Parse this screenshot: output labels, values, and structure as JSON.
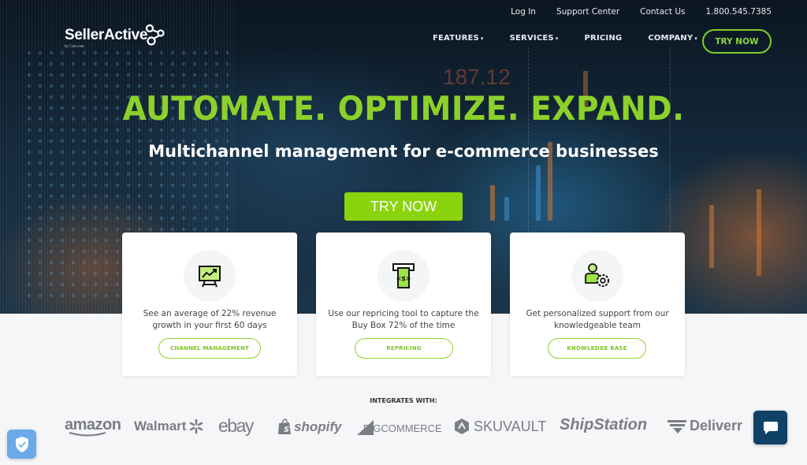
{
  "brand": {
    "name": "SellerActive",
    "tagline": "by Cart.com"
  },
  "topbar": {
    "login": "Log In",
    "support": "Support Center",
    "contact": "Contact Us",
    "phone": "1.800.545.7385"
  },
  "nav": {
    "items": [
      {
        "label": "FEATURES",
        "caret": "▾"
      },
      {
        "label": "SERVICES",
        "caret": "▾"
      },
      {
        "label": "PRICING",
        "caret": ""
      },
      {
        "label": "COMPANY",
        "caret": "▾"
      }
    ],
    "cta": "TRY NOW"
  },
  "hero": {
    "headline": "AUTOMATE. OPTIMIZE. EXPAND.",
    "subhead": "Multichannel management for e-commerce businesses",
    "cta": "TRY NOW",
    "background_ticker": "187.12"
  },
  "cards": [
    {
      "icon": "presentation-chart-icon",
      "desc": "See an average of 22% revenue growth in your first 60 days",
      "button": "CHANNEL MANAGEMENT"
    },
    {
      "icon": "cash-dispenser-icon",
      "desc": "Use our repricing tool to capture the Buy Box 72% of the time",
      "button": "REPRICING"
    },
    {
      "icon": "user-gear-icon",
      "desc": "Get personalized support from our knowledgeable team",
      "button": "KNOWLEDGE BASE"
    }
  ],
  "integrations": {
    "title": "INTEGRATES WITH:",
    "logos": [
      "amazon",
      "Walmart",
      "ebay",
      "shopify",
      "BIGCOMMERCE",
      "SKUVAULT",
      "ShipStation",
      "Deliverr"
    ]
  },
  "colors": {
    "accent": "#8cd12b",
    "cta": "#8bd30c",
    "chat": "#0f4266",
    "shield": "#6aaae8",
    "logo_gray": "#7a7d83"
  }
}
